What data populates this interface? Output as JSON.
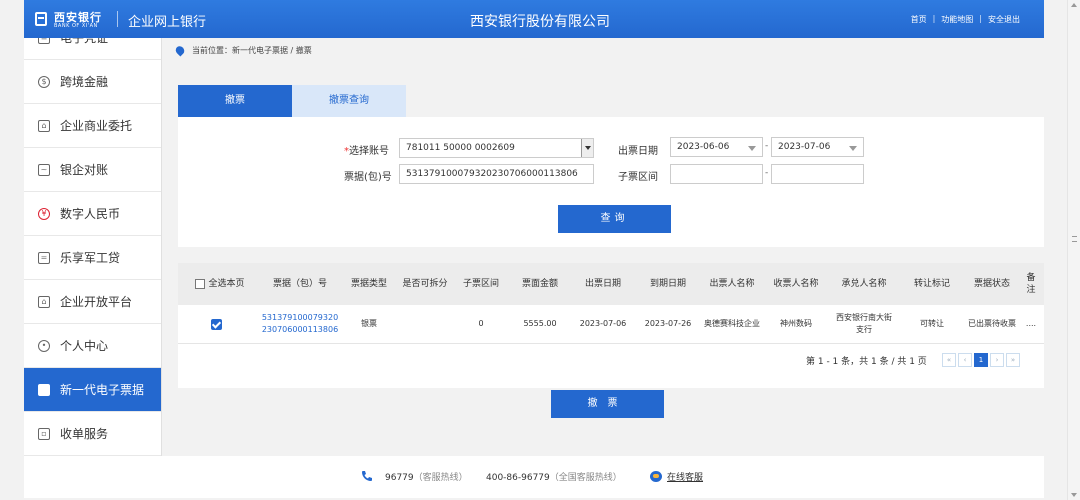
{
  "header": {
    "logo_cn": "西安银行",
    "logo_en": "BANK OF XI'AN",
    "portal_title": "企业网上银行",
    "company": "西安银行股份有限公司",
    "links": [
      "首页",
      "功能地图",
      "安全退出"
    ]
  },
  "sidebar": {
    "items": [
      {
        "label": "电子凭证",
        "icon": "receipt-icon"
      },
      {
        "label": "跨境金融",
        "icon": "currency-icon"
      },
      {
        "label": "企业商业委托",
        "icon": "building-icon"
      },
      {
        "label": "银企对账",
        "icon": "ledger-icon"
      },
      {
        "label": "数字人民币",
        "icon": "rmb-icon"
      },
      {
        "label": "乐享军工贷",
        "icon": "card-icon"
      },
      {
        "label": "企业开放平台",
        "icon": "platform-icon"
      },
      {
        "label": "个人中心",
        "icon": "user-icon"
      },
      {
        "label": "新一代电子票据",
        "icon": "bill-icon"
      },
      {
        "label": "收单服务",
        "icon": "pos-icon"
      }
    ]
  },
  "breadcrumb": "当前位置：新一代电子票据 / 撤票",
  "tabs": [
    "撤票",
    "撤票查询"
  ],
  "form": {
    "account_label": "选择账号",
    "account_value": "781011 50000 0002609",
    "issue_date_label": "出票日期",
    "date_from": "2023-06-06",
    "date_to": "2023-07-06",
    "bill_no_label": "票据(包)号",
    "bill_no_value": "531379100079320230706000113806",
    "sub_range_label": "子票区间",
    "sub_from": "",
    "sub_to": "",
    "separator": "-",
    "query_button": "查询"
  },
  "table": {
    "headers": [
      "全选本页",
      "票据（包）号",
      "票据类型",
      "是否可拆分",
      "子票区间",
      "票面金额",
      "出票日期",
      "到期日期",
      "出票人名称",
      "收票人名称",
      "承兑人名称",
      "转让标记",
      "票据状态",
      "备注"
    ],
    "rows": [
      {
        "bill_no_1": "531379100079320",
        "bill_no_2": "230706000113806",
        "type": "银票",
        "splittable": "",
        "sub_range": "0",
        "amount": "5555.00",
        "issue_date": "2023-07-06",
        "due_date": "2023-07-26",
        "drawer": "奥德赛科技企业",
        "payee": "神州数码",
        "acceptor": "西安银行南大街支行",
        "transfer": "可转让",
        "status": "已出票待收票",
        "remark": "...."
      }
    ],
    "pager_text": "第 1 - 1 条，共 1 条 / 共 1 页",
    "pager_buttons": [
      "«",
      "‹",
      "1",
      "›",
      "»"
    ]
  },
  "withdraw_button": "撤票",
  "footer": {
    "hotline": "96779",
    "hotline_label": "（客服热线）",
    "national": "400-86-96779",
    "national_label": "（全国客服热线）",
    "online": "在线客服"
  }
}
